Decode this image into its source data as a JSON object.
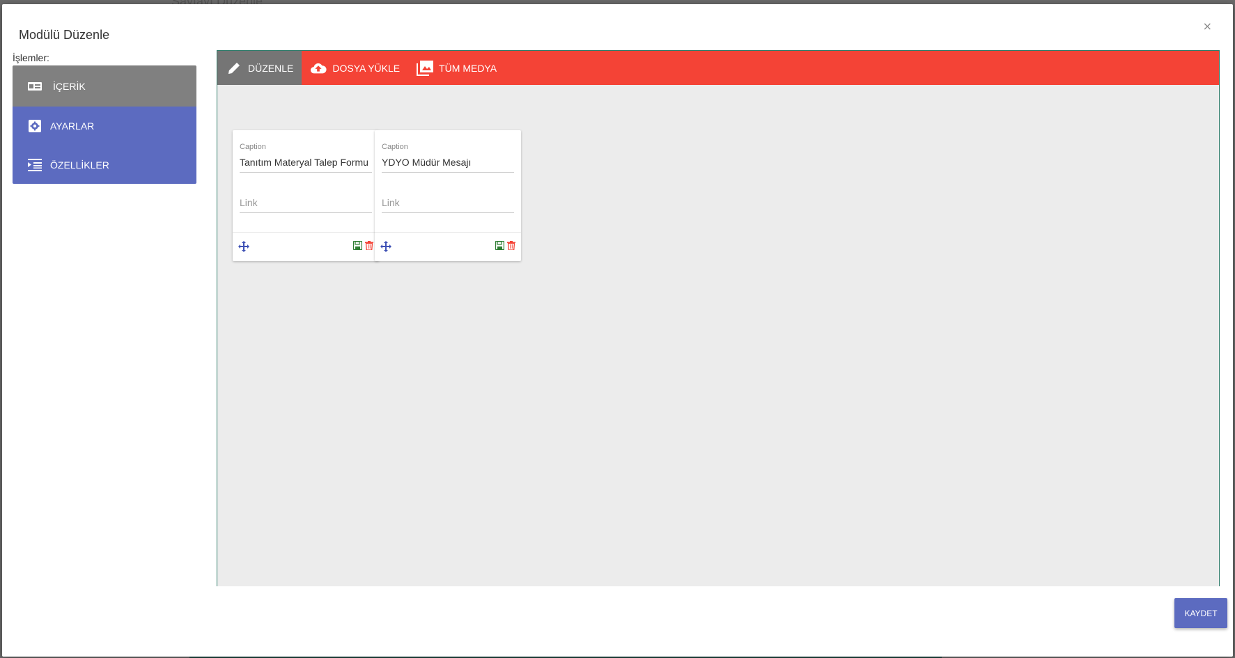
{
  "backdrop": {
    "title": "Sayfayı Düzenle"
  },
  "modal": {
    "title": "Modülü Düzenle",
    "close_label": "×",
    "ops_label": "İşlemler:"
  },
  "sidebar": {
    "items": [
      {
        "label": "İÇERİK",
        "icon": "content-card-icon",
        "active": true
      },
      {
        "label": "AYARLAR",
        "icon": "gear-icon",
        "active": false
      },
      {
        "label": "ÖZELLİKLER",
        "icon": "indent-list-icon",
        "active": false
      }
    ]
  },
  "tabs": [
    {
      "label": "DÜZENLE",
      "icon": "pencil-icon",
      "active": true
    },
    {
      "label": "DOSYA YÜKLE",
      "icon": "cloud-upload-icon",
      "active": false
    },
    {
      "label": "TÜM MEDYA",
      "icon": "photo-library-icon",
      "active": false
    }
  ],
  "cards": [
    {
      "caption_label": "Caption",
      "caption_value": "Tanıtım Materyal Talep Formu",
      "link_placeholder": "Link"
    },
    {
      "caption_label": "Caption",
      "caption_value": "YDYO Müdür Mesajı",
      "link_placeholder": "Link"
    }
  ],
  "footer": {
    "save_label": "KAYDET"
  },
  "colors": {
    "sidebar_active": "#808080",
    "sidebar_item": "#5c6bc0",
    "tab_bar": "#f44336",
    "tab_active": "#757575",
    "save_icon": "#2e7d32",
    "delete_icon": "#f44336",
    "move_icon": "#3f51b5"
  }
}
